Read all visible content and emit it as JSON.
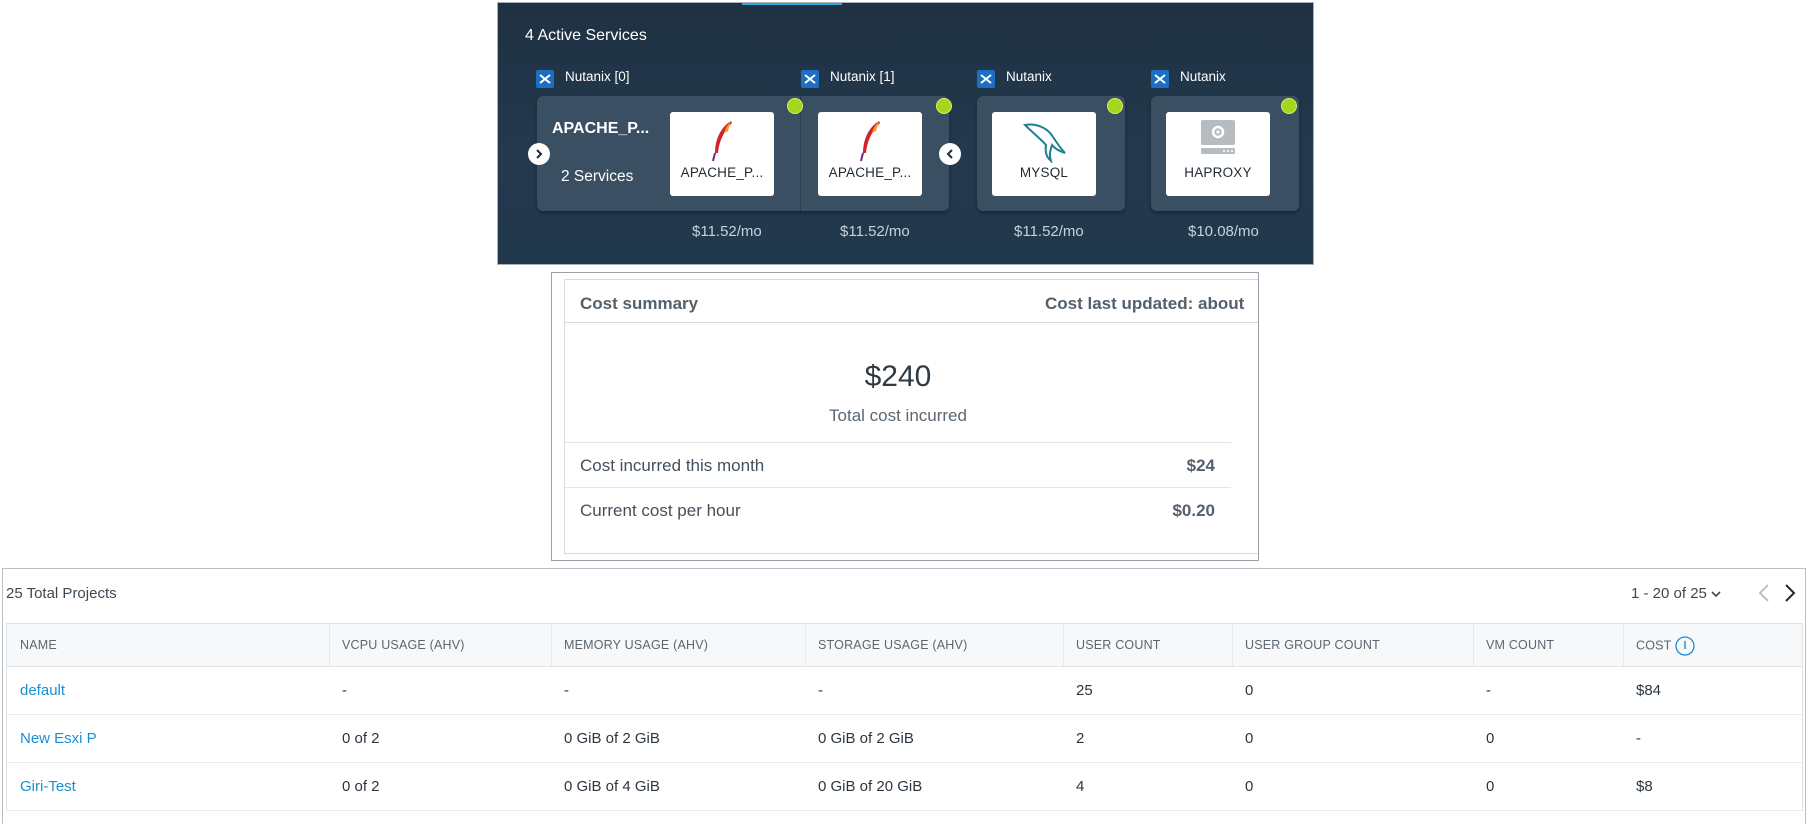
{
  "services": {
    "title": "4 Active Services",
    "providers": [
      "Nutanix [0]",
      "Nutanix [1]",
      "Nutanix",
      "Nutanix"
    ],
    "group": {
      "name": "APACHE_P...",
      "count": "2 Services"
    },
    "cards": [
      {
        "label": "APACHE_P...",
        "icon": "apache-feather-icon",
        "price": "$11.52/mo"
      },
      {
        "label": "APACHE_P...",
        "icon": "apache-feather-icon",
        "price": "$11.52/mo"
      },
      {
        "label": "MYSQL",
        "icon": "mysql-dolphin-icon",
        "price": "$11.52/mo"
      },
      {
        "label": "HAPROXY",
        "icon": "server-gear-icon",
        "price": "$10.08/mo"
      }
    ],
    "status_color": "#a6d61b"
  },
  "cost_summary": {
    "title": "Cost summary",
    "last_updated": "Cost last updated: about",
    "total_amount": "$240",
    "total_label": "Total cost incurred",
    "rows": [
      {
        "label": "Cost incurred this month",
        "value": "$24"
      },
      {
        "label": "Current cost per hour",
        "value": "$0.20"
      }
    ]
  },
  "projects": {
    "title": "25 Total Projects",
    "pagination": "1 - 20 of 25",
    "columns": [
      "NAME",
      "VCPU USAGE (AHV)",
      "MEMORY USAGE (AHV)",
      "STORAGE USAGE (AHV)",
      "USER COUNT",
      "USER GROUP COUNT",
      "VM COUNT",
      "COST"
    ],
    "rows": [
      [
        "default",
        "-",
        "-",
        "-",
        "25",
        "0",
        "-",
        "$84"
      ],
      [
        "New Esxi P",
        "0 of 2",
        "0 GiB of 2 GiB",
        "0 GiB of 2 GiB",
        "2",
        "0",
        "0",
        "-"
      ],
      [
        "Giri-Test",
        "0 of 2",
        "0 GiB of 4 GiB",
        "0 GiB of 20 GiB",
        "4",
        "0",
        "0",
        "$8"
      ]
    ],
    "link_color": "#1b8fd0"
  }
}
